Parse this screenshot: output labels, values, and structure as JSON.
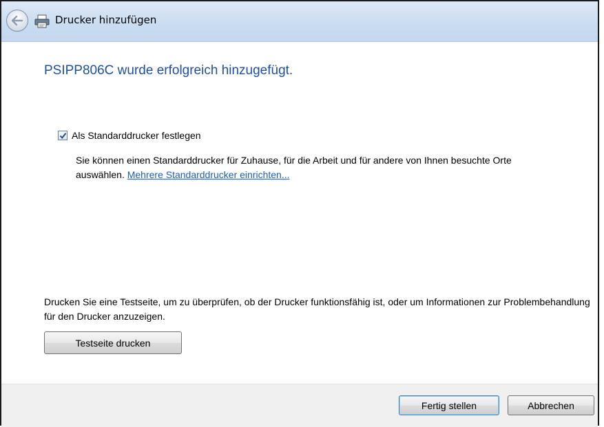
{
  "window": {
    "title": "Drucker hinzufügen"
  },
  "main": {
    "heading": "PSIPP806C wurde erfolgreich hinzugefügt.",
    "default_printer": {
      "checked": true,
      "label": "Als Standarddrucker festlegen",
      "description": "Sie können einen Standarddrucker für Zuhause, für die Arbeit und für andere von Ihnen besuchte Orte auswählen.",
      "link": "Mehrere Standarddrucker einrichten..."
    },
    "test_page_info": "Drucken Sie eine Testseite, um zu überprüfen, ob der Drucker funktionsfähig ist, oder um Informationen zur Problembehandlung für den Drucker anzuzeigen.",
    "test_page_button": "Testseite drucken"
  },
  "footer": {
    "finish_button": "Fertig stellen",
    "cancel_button": "Abbrechen"
  },
  "icons": {
    "back": "back-arrow-icon",
    "printer": "printer-icon",
    "checkmark": "checkmark-icon"
  },
  "colors": {
    "heading": "#1e4f9c",
    "link": "#1a5fb4",
    "titlebar": "#c9dcf0",
    "footer": "#f0f0f0"
  }
}
